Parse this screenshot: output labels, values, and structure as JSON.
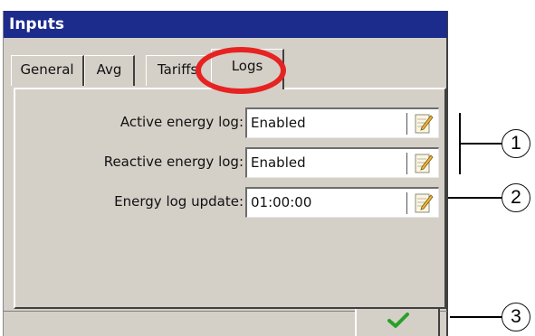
{
  "window": {
    "title": "Inputs"
  },
  "tabs": [
    {
      "label": "General"
    },
    {
      "label": "Avg"
    },
    {
      "label": "Tariffs"
    },
    {
      "label": "Logs",
      "active": true
    }
  ],
  "fields": [
    {
      "label": "Active energy log:",
      "value": "Enabled",
      "icon": "edit-icon"
    },
    {
      "label": "Reactive energy log:",
      "value": "Enabled",
      "icon": "edit-icon"
    },
    {
      "label": "Energy log update:",
      "value": "01:00:00",
      "icon": "edit-icon"
    }
  ],
  "footer": {
    "ok_icon": "checkmark-icon"
  },
  "callouts": [
    "1",
    "2",
    "3"
  ],
  "colors": {
    "titlebar": "#1c2c8c",
    "highlight": "#e62322",
    "checkmark": "#2aa02a"
  }
}
